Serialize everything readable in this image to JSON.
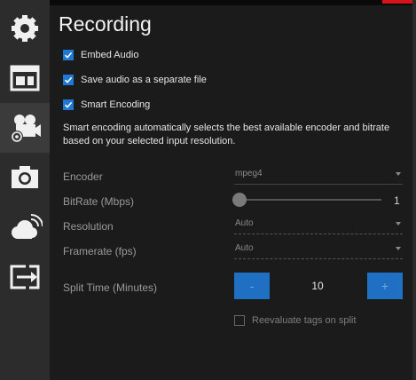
{
  "sidebar": {
    "items": [
      {
        "icon": "gear-icon"
      },
      {
        "icon": "layout-icon"
      },
      {
        "icon": "video-camera-settings-icon",
        "active": true
      },
      {
        "icon": "camera-icon"
      },
      {
        "icon": "cloud-icon"
      },
      {
        "icon": "export-icon"
      }
    ]
  },
  "page": {
    "title": "Recording",
    "checkboxes": {
      "embed_audio": {
        "label": "Embed Audio",
        "checked": true
      },
      "separate_audio": {
        "label": "Save audio as a separate file",
        "checked": true
      },
      "smart_encoding": {
        "label": "Smart Encoding",
        "checked": true
      }
    },
    "description": "Smart encoding automatically selects the best available encoder and bitrate based on your selected input resolution.",
    "encoder": {
      "label": "Encoder",
      "value": "mpeg4"
    },
    "bitrate": {
      "label": "BitRate (Mbps)",
      "value": "1",
      "fraction": 0.0
    },
    "resolution": {
      "label": "Resolution",
      "value": "Auto"
    },
    "framerate": {
      "label": "Framerate (fps)",
      "value": "Auto"
    },
    "split_time": {
      "label": "Split Time (Minutes)",
      "value": "10",
      "decrement": "-",
      "increment": "+"
    },
    "reevaluate": {
      "label": "Reevaluate tags on split",
      "checked": false
    }
  },
  "colors": {
    "accent": "#1e78d4",
    "close": "#d8141b"
  }
}
